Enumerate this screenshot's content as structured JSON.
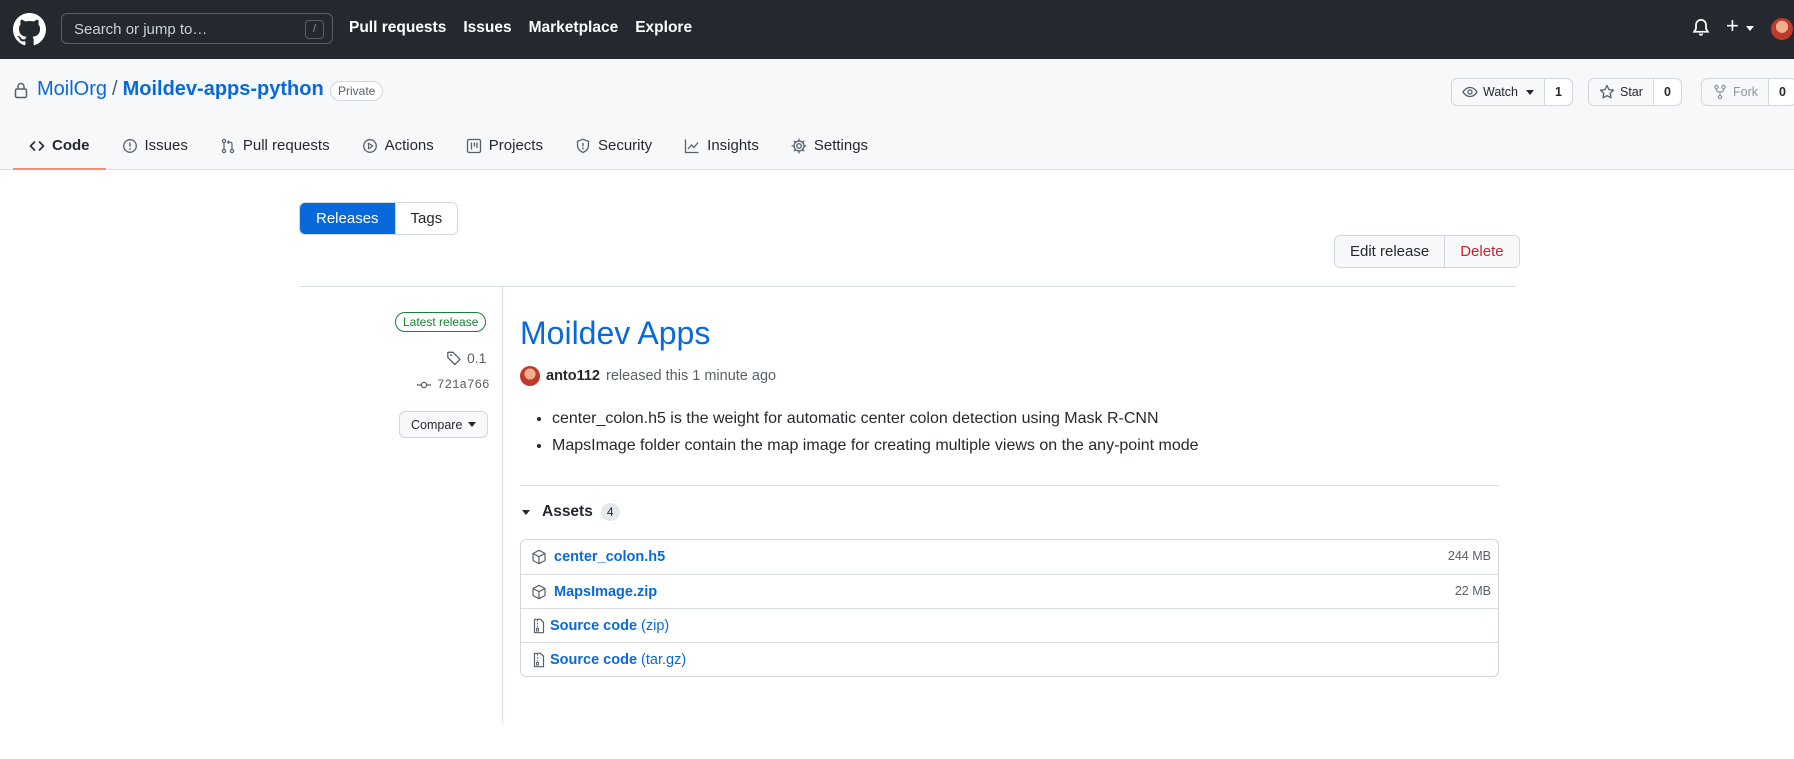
{
  "header": {
    "search_placeholder": "Search or jump to…",
    "search_shortcut": "/",
    "nav": [
      "Pull requests",
      "Issues",
      "Marketplace",
      "Explore"
    ],
    "plus_label": "+"
  },
  "repo": {
    "owner": "MoilOrg",
    "separator": "/",
    "name": "Moildev-apps-python",
    "visibility": "Private",
    "watch": {
      "label": "Watch",
      "count": "1"
    },
    "star": {
      "label": "Star",
      "count": "0"
    },
    "fork": {
      "label": "Fork",
      "count": "0"
    },
    "tabs": [
      "Code",
      "Issues",
      "Pull requests",
      "Actions",
      "Projects",
      "Security",
      "Insights",
      "Settings"
    ]
  },
  "subnav": {
    "releases": "Releases",
    "tags": "Tags"
  },
  "release_actions": {
    "edit": "Edit release",
    "delete": "Delete"
  },
  "release": {
    "badge": "Latest release",
    "tag": "0.1",
    "commit": "721a766",
    "compare": "Compare",
    "title": "Moildev Apps",
    "author": "anto112",
    "released_text": "released this 1 minute ago",
    "notes": [
      "center_colon.h5 is the weight for automatic center colon detection using Mask R-CNN",
      "MapsImage folder contain the map image for creating multiple views on the any-point mode"
    ]
  },
  "assets": {
    "label": "Assets",
    "count": "4",
    "items": [
      {
        "name": "center_colon.h5",
        "ext": "",
        "size": "244 MB",
        "icon": "package-icon"
      },
      {
        "name": "MapsImage.zip",
        "ext": "",
        "size": "22 MB",
        "icon": "package-icon"
      },
      {
        "name": "Source code",
        "ext": "(zip)",
        "size": "",
        "icon": "file-zip-icon"
      },
      {
        "name": "Source code",
        "ext": "(tar.gz)",
        "size": "",
        "icon": "file-zip-icon"
      }
    ]
  },
  "colors": {
    "header_bg": "#24292f",
    "link": "#0969da",
    "primary_button": "#0969da",
    "danger": "#cf222e",
    "success": "#1a7f37",
    "tab_underline": "#fd8c73"
  }
}
